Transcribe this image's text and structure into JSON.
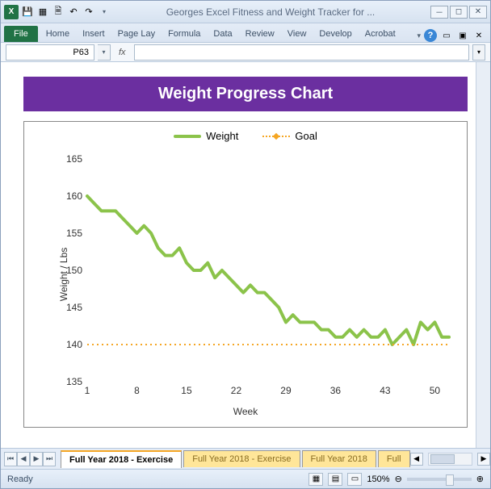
{
  "titlebar": {
    "doc_title": "Georges Excel Fitness and Weight Tracker for ..."
  },
  "ribbon": {
    "file": "File",
    "tabs": [
      "Home",
      "Insert",
      "Page Lay",
      "Formula",
      "Data",
      "Review",
      "View",
      "Develop",
      "Acrobat"
    ]
  },
  "formula_bar": {
    "name_box": "P63",
    "fx": "fx",
    "formula": ""
  },
  "chart_title": "Weight Progress Chart",
  "legend": {
    "weight": "Weight",
    "goal": "Goal"
  },
  "axes": {
    "ylabel": "Weight / Lbs",
    "xlabel": "Week"
  },
  "sheet_tabs": {
    "active": "Full Year 2018 - Exercise",
    "others": [
      "Full Year 2018 - Exercise",
      "Full Year 2018",
      "Full"
    ]
  },
  "statusbar": {
    "ready": "Ready",
    "zoom": "150%"
  },
  "chart_data": {
    "type": "line",
    "title": "Weight Progress Chart",
    "xlabel": "Week",
    "ylabel": "Weight / Lbs",
    "ylim": [
      135,
      165
    ],
    "x_ticks": [
      1,
      8,
      15,
      22,
      29,
      36,
      43,
      50
    ],
    "y_ticks": [
      135,
      140,
      145,
      150,
      155,
      160,
      165
    ],
    "x": [
      1,
      2,
      3,
      4,
      5,
      6,
      7,
      8,
      9,
      10,
      11,
      12,
      13,
      14,
      15,
      16,
      17,
      18,
      19,
      20,
      21,
      22,
      23,
      24,
      25,
      26,
      27,
      28,
      29,
      30,
      31,
      32,
      33,
      34,
      35,
      36,
      37,
      38,
      39,
      40,
      41,
      42,
      43,
      44,
      45,
      46,
      47,
      48,
      49,
      50,
      51,
      52
    ],
    "series": [
      {
        "name": "Weight",
        "color": "#8bc34a",
        "values": [
          160,
          159,
          158,
          158,
          158,
          157,
          156,
          155,
          156,
          155,
          153,
          152,
          152,
          153,
          151,
          150,
          150,
          151,
          149,
          150,
          149,
          148,
          147,
          148,
          147,
          147,
          146,
          145,
          143,
          144,
          143,
          143,
          143,
          142,
          142,
          141,
          141,
          142,
          141,
          142,
          141,
          141,
          142,
          140,
          141,
          142,
          140,
          143,
          142,
          143,
          141,
          141
        ]
      },
      {
        "name": "Goal",
        "color": "#f5a623",
        "values": [
          140,
          140,
          140,
          140,
          140,
          140,
          140,
          140,
          140,
          140,
          140,
          140,
          140,
          140,
          140,
          140,
          140,
          140,
          140,
          140,
          140,
          140,
          140,
          140,
          140,
          140,
          140,
          140,
          140,
          140,
          140,
          140,
          140,
          140,
          140,
          140,
          140,
          140,
          140,
          140,
          140,
          140,
          140,
          140,
          140,
          140,
          140,
          140,
          140,
          140,
          140,
          140
        ]
      }
    ]
  }
}
